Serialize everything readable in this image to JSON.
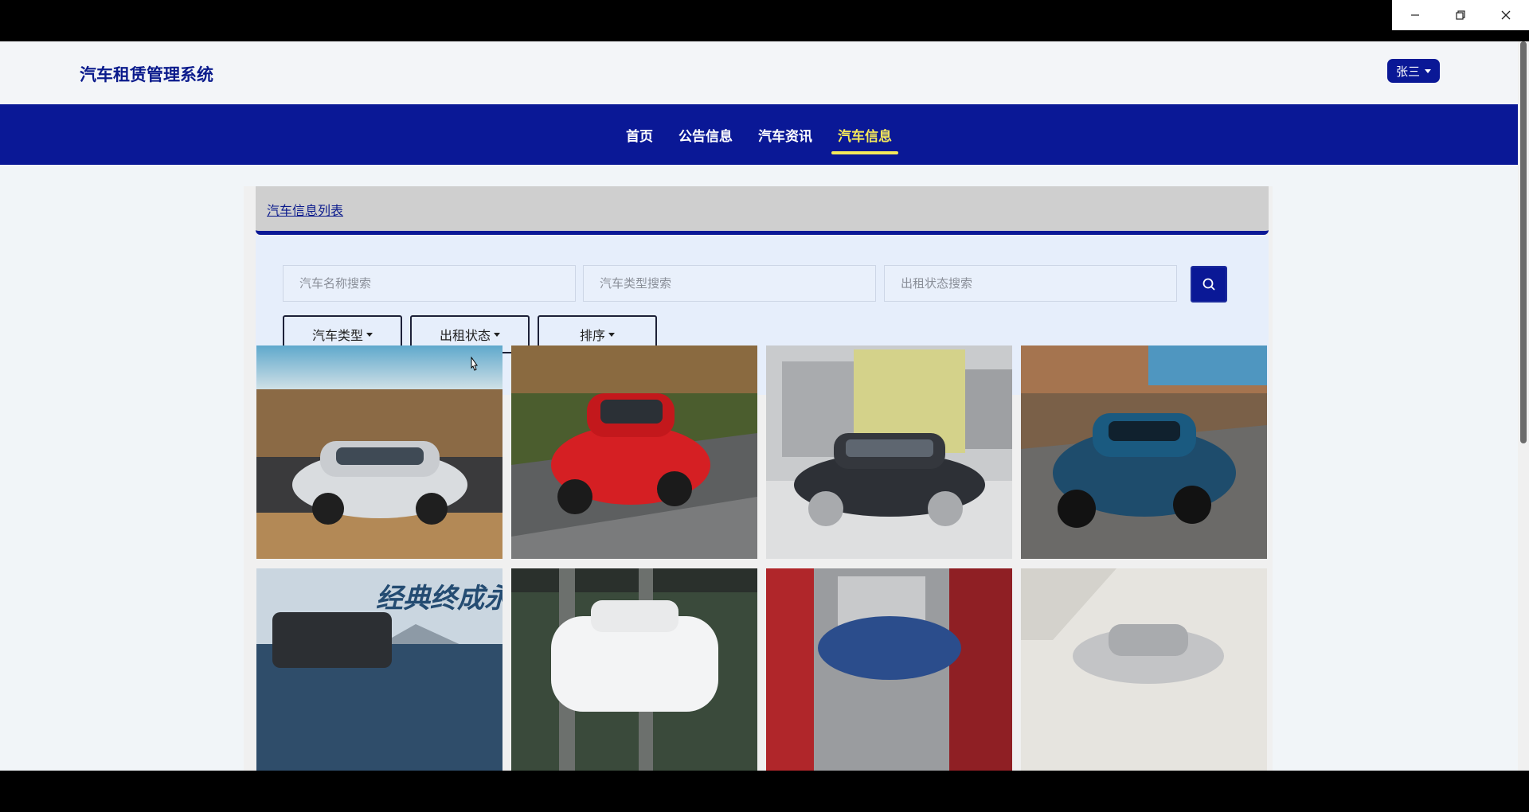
{
  "window": {
    "minimize_icon": "minimize-icon",
    "restore_icon": "restore-icon",
    "close_icon": "close-icon"
  },
  "header": {
    "brand": "汽车租赁管理系统",
    "user": "张三"
  },
  "nav": {
    "items": [
      "首页",
      "公告信息",
      "汽车资讯",
      "汽车信息"
    ],
    "active": "汽车信息"
  },
  "breadcrumb": "汽车信息列表",
  "search": {
    "name_placeholder": "汽车名称搜索",
    "type_placeholder": "汽车类型搜索",
    "status_placeholder": "出租状态搜索",
    "button_icon": "search-icon"
  },
  "filters": {
    "type": "汽车类型",
    "status": "出租状态",
    "sort": "排序"
  },
  "cars": [
    {
      "image": "silver-porsche-taycan-wagon"
    },
    {
      "image": "red-ford-mustang"
    },
    {
      "image": "black-mercedes-sedan"
    },
    {
      "image": "blue-hypercar-on-road"
    },
    {
      "image": "black-suv-banner",
      "banner_text": "经典终成永恒"
    },
    {
      "image": "white-suv"
    },
    {
      "image": "blue-car-blurred-street"
    },
    {
      "image": "silver-sedan-studio"
    }
  ],
  "colors": {
    "primary": "#0a1896",
    "active_nav": "#f5e95a",
    "brand_text": "#0a1a8c"
  }
}
